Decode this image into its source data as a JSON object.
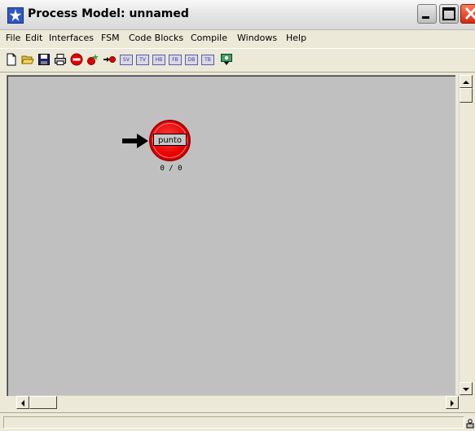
{
  "window": {
    "title": "Process Model: unnamed",
    "app_icon": "star-icon",
    "controls": [
      "minimize-icon",
      "maximize-icon",
      "close-icon"
    ]
  },
  "menubar": {
    "items": [
      "File",
      "Edit",
      "Interfaces",
      "FSM",
      "Code Blocks",
      "Compile",
      "Windows",
      "Help"
    ]
  },
  "toolbar": {
    "buttons": [
      {
        "icon": "new-document-icon"
      },
      {
        "icon": "open-folder-icon"
      },
      {
        "icon": "save-icon"
      },
      {
        "icon": "print-icon"
      },
      {
        "icon": "stop-icon"
      },
      {
        "icon": "create-state-icon"
      },
      {
        "icon": "create-transition-icon"
      },
      {
        "label": "SV"
      },
      {
        "label": "TV"
      },
      {
        "label": "HB"
      },
      {
        "label": "FB"
      },
      {
        "label": "DB"
      },
      {
        "label": "TB"
      },
      {
        "icon": "compile-icon"
      }
    ]
  },
  "canvas": {
    "state": {
      "name": "punto",
      "executive_count": "0 / 0",
      "is_initial": true,
      "color": "#e60000"
    }
  },
  "colors": {
    "canvas_bg": "#c0c0c0",
    "chrome_bg": "#ece9d8",
    "state_red": "#e60000"
  }
}
